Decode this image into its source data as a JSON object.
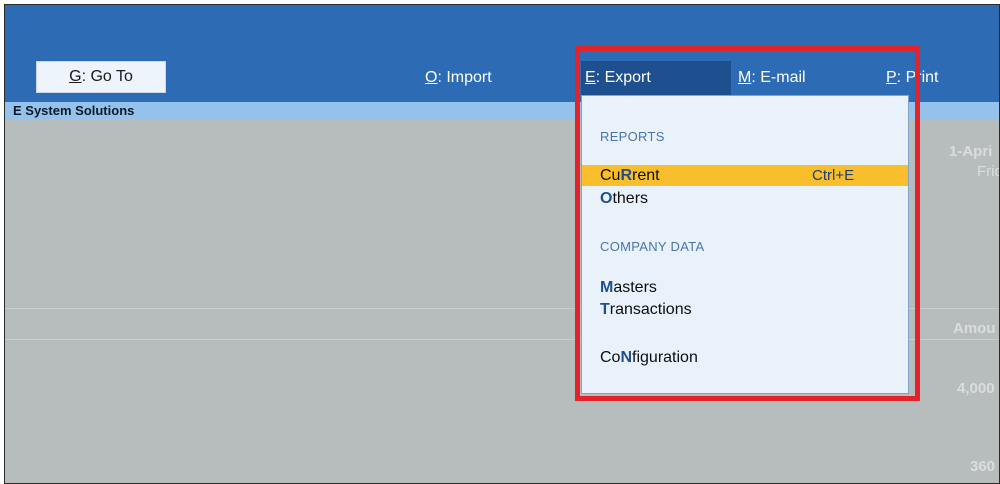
{
  "toolbar": {
    "goto": {
      "key": "G",
      "label": "Go To"
    },
    "import": {
      "key": "O",
      "label": "Import"
    },
    "export": {
      "key": "E",
      "label": "Export"
    },
    "email": {
      "key": "M",
      "label": "E-mail"
    },
    "print": {
      "key": "P",
      "label": "Print"
    }
  },
  "company": {
    "name": "E System Solutions"
  },
  "background": {
    "date": "1-Apri",
    "day": "Frid",
    "column_header": "Amou",
    "value1": "4,000",
    "value2": "360"
  },
  "export_menu": {
    "reports_header": "REPORTS",
    "current": {
      "pre": "Cu",
      "hk": "R",
      "post": "rent",
      "shortcut": "Ctrl+E"
    },
    "others": {
      "pre": "",
      "hk": "O",
      "post": "thers"
    },
    "company_data_header": "COMPANY DATA",
    "masters": {
      "pre": "",
      "hk": "M",
      "post": "asters"
    },
    "transactions": {
      "pre": "",
      "hk": "T",
      "post": "ransactions"
    },
    "configuration": {
      "pre": "Co",
      "hk": "N",
      "post": "figuration"
    }
  },
  "colors": {
    "toolbar_bg": "#2d6cb5",
    "active_menu": "#1e4f8e",
    "highlight": "#f8be2c",
    "annotation": "#e3222a"
  }
}
